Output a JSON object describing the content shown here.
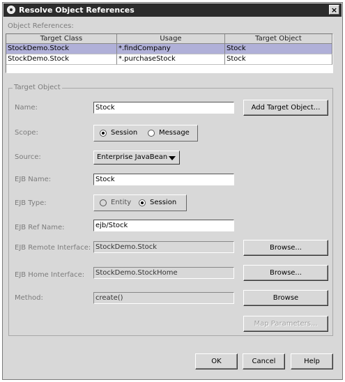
{
  "window": {
    "title": "Resolve Object References",
    "close_glyph": "×"
  },
  "references": {
    "label": "Object References:",
    "columns": [
      "Target Class",
      "Usage",
      "Target Object"
    ],
    "rows": [
      {
        "target_class": "StockDemo.Stock",
        "usage": "*.findCompany",
        "target_object": "Stock",
        "selected": true
      },
      {
        "target_class": "StockDemo.Stock",
        "usage": "*.purchaseStock",
        "target_object": "Stock",
        "selected": false
      }
    ]
  },
  "target_object": {
    "legend": "Target Object",
    "name": {
      "label": "Name:",
      "value": "Stock"
    },
    "add_target_button": "Add Target Object...",
    "scope": {
      "label": "Scope:",
      "options": [
        "Session",
        "Message"
      ],
      "selected": "Session"
    },
    "source": {
      "label": "Source:",
      "value": "Enterprise JavaBean"
    },
    "ejb_name": {
      "label": "EJB Name:",
      "value": "Stock"
    },
    "ejb_type": {
      "label": "EJB Type:",
      "options": [
        "Entity",
        "Session"
      ],
      "selected": "Session"
    },
    "ejb_ref_name": {
      "label": "EJB Ref Name:",
      "value": "ejb/Stock"
    },
    "ejb_remote_interface": {
      "label": "EJB Remote Interface:",
      "value": "StockDemo.Stock",
      "button": "Browse..."
    },
    "ejb_home_interface": {
      "label": "EJB Home Interface:",
      "value": "StockDemo.StockHome",
      "button": "Browse..."
    },
    "method": {
      "label": "Method:",
      "value": "create()",
      "button": "Browse"
    },
    "map_parameters_button": "Map Parameters..."
  },
  "footer": {
    "ok": "OK",
    "cancel": "Cancel",
    "help": "Help"
  }
}
